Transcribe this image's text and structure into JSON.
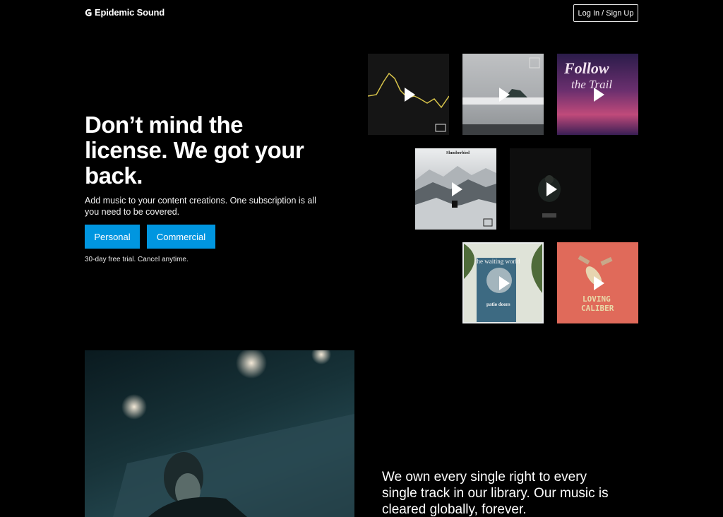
{
  "header": {
    "brand": "Epidemic Sound",
    "login_label": "Log In / Sign Up"
  },
  "hero": {
    "title": "Don’t mind the license. We got your back.",
    "subtitle": "Add music to your content creations. One subscription is all you need to be covered.",
    "personal_label": "Personal",
    "commercial_label": "Commercial",
    "trial_note": "30-day free trial. Cancel anytime."
  },
  "albums": {
    "a3_title": "Follow",
    "a3_sub": "the Trail",
    "a4_title": "Slumberbird",
    "a6_title": "the waiting world",
    "a6_sub": "patio doors",
    "a7_title_1": "LOVING",
    "a7_title_2": "CALIBER"
  },
  "section2": {
    "rights_text": "We own every single right to every single track in our library. Our music is cleared globally, forever."
  },
  "colors": {
    "accent": "#0096e0",
    "background": "#000000"
  }
}
